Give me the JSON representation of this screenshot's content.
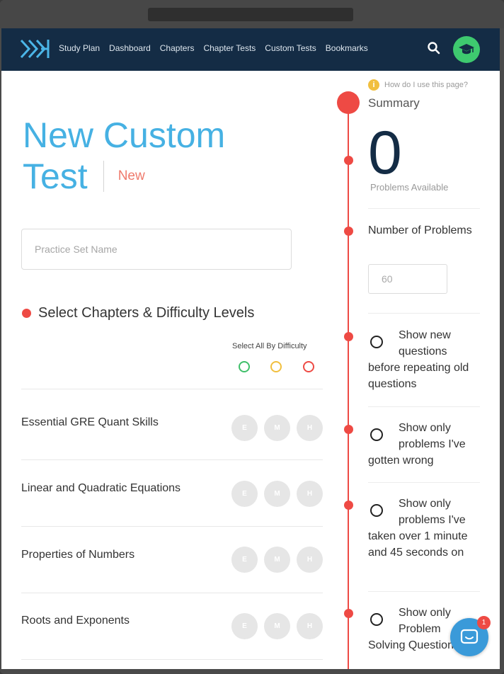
{
  "nav": {
    "links": [
      "Study Plan",
      "Dashboard",
      "Chapters",
      "Chapter Tests",
      "Custom Tests",
      "Bookmarks"
    ],
    "colors": {
      "bar": "#142c45",
      "avatar": "#3ec96f"
    }
  },
  "page": {
    "title_line1": "New Custom",
    "title_line2": "Test",
    "status_badge": "New",
    "practice_set_placeholder": "Practice Set Name"
  },
  "chapters_section": {
    "heading": "Select Chapters & Difficulty Levels",
    "select_all_label": "Select All By Difficulty",
    "difficulty_colors": [
      "#3fbf6a",
      "#f1bf3e",
      "#ee4a44"
    ],
    "difficulty_letters": [
      "E",
      "M",
      "H"
    ],
    "chapters": [
      "Essential GRE Quant Skills",
      "Linear and Quadratic Equations",
      "Properties of Numbers",
      "Roots and Exponents"
    ]
  },
  "summary": {
    "help_text": "How do I use this page?",
    "heading": "Summary",
    "problems_available": "0",
    "problems_available_label": "Problems Available",
    "number_of_problems_label": "Number of Problems",
    "number_of_problems_placeholder": "60",
    "options": [
      "Show new questions before repeating old questions",
      "Show only problems I've gotten wrong",
      "Show only problems I've taken over 1 minute and 45 seconds on",
      "Show only Problem Solving Questions"
    ]
  },
  "chat": {
    "unread_count": "1"
  }
}
